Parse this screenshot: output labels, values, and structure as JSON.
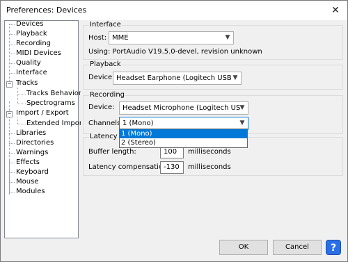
{
  "window": {
    "title": "Preferences: Devices",
    "close_glyph": "✕"
  },
  "tree": {
    "items": [
      {
        "label": "Devices"
      },
      {
        "label": "Playback"
      },
      {
        "label": "Recording"
      },
      {
        "label": "MIDI Devices"
      },
      {
        "label": "Quality"
      },
      {
        "label": "Interface"
      },
      {
        "label": "Tracks"
      },
      {
        "label": "Tracks Behaviors"
      },
      {
        "label": "Spectrograms"
      },
      {
        "label": "Import / Export"
      },
      {
        "label": "Extended Import"
      },
      {
        "label": "Libraries"
      },
      {
        "label": "Directories"
      },
      {
        "label": "Warnings"
      },
      {
        "label": "Effects"
      },
      {
        "label": "Keyboard"
      },
      {
        "label": "Mouse"
      },
      {
        "label": "Modules"
      }
    ],
    "collapse_glyph": "−"
  },
  "interface": {
    "title": "Interface",
    "host_label": "Host:",
    "host_value": "MME",
    "using_text": "Using: PortAudio V19.5.0-devel, revision unknown"
  },
  "playback": {
    "title": "Playback",
    "device_label": "Device:",
    "device_value": "Headset Earphone (Logitech USB"
  },
  "recording": {
    "title": "Recording",
    "device_label": "Device:",
    "device_value": "Headset Microphone (Logitech US",
    "channels_label": "Channels:",
    "channels_value": "1 (Mono)",
    "channels_options": [
      "1 (Mono)",
      "2 (Stereo)"
    ]
  },
  "latency": {
    "title": "Latency",
    "buffer_label": "Buffer length:",
    "buffer_value": "100",
    "buffer_unit": "milliseconds",
    "comp_label": "Latency compensation:",
    "comp_value": "-130",
    "comp_unit": "milliseconds"
  },
  "buttons": {
    "ok": "OK",
    "cancel": "Cancel",
    "help": "?"
  },
  "colors": {
    "selection": "#0078d7",
    "help": "#2b6fe6"
  }
}
